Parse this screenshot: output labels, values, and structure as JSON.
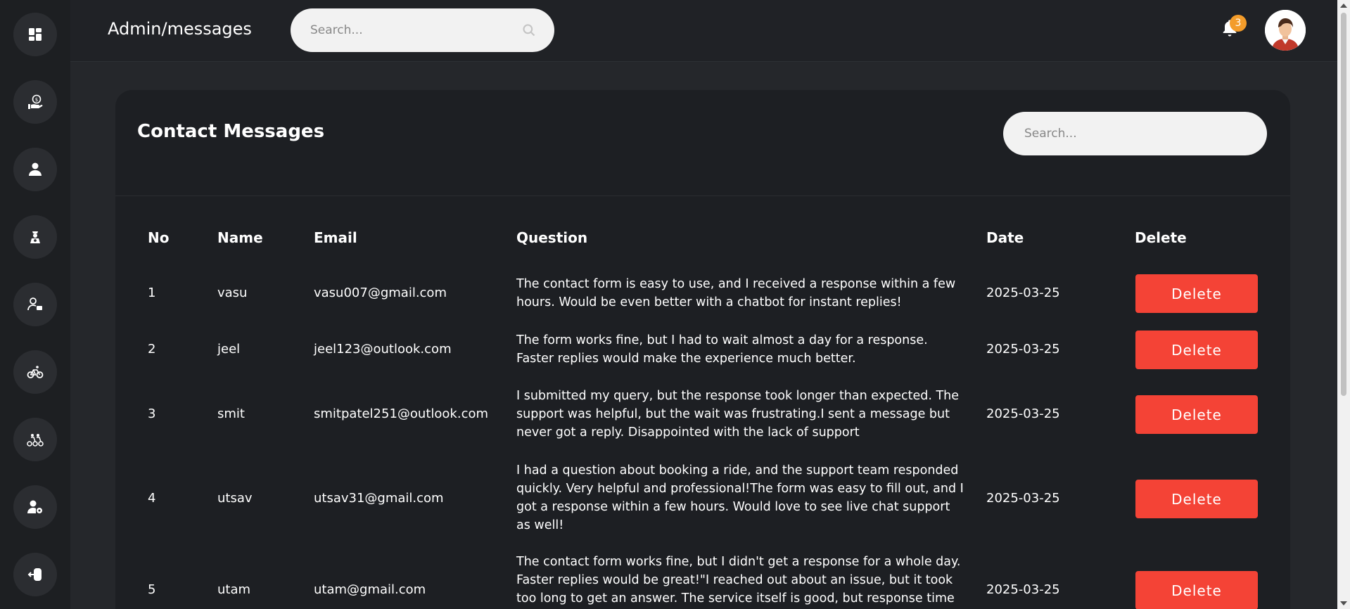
{
  "header": {
    "title": "Admin/messages",
    "search_placeholder": "Search...",
    "notification_count": "3"
  },
  "sidebar": {
    "items": [
      {
        "icon": "dashboard-icon"
      },
      {
        "icon": "payment-hand-icon"
      },
      {
        "icon": "user-icon"
      },
      {
        "icon": "driver-icon"
      },
      {
        "icon": "user-card-icon"
      },
      {
        "icon": "bike-icon"
      },
      {
        "icon": "bikes-icon"
      },
      {
        "icon": "user-settings-icon"
      },
      {
        "icon": "logout-icon"
      }
    ]
  },
  "main": {
    "title": "Contact Messages",
    "search_placeholder": "Search...",
    "columns": [
      "No",
      "Name",
      "Email",
      "Question",
      "Date",
      "Delete"
    ],
    "delete_label": "Delete",
    "rows": [
      {
        "no": "1",
        "name": "vasu",
        "email": "vasu007@gmail.com",
        "question": "The contact form is easy to use, and I received a response within a few hours. Would be even better with a chatbot for instant replies!",
        "date": "2025-03-25"
      },
      {
        "no": "2",
        "name": "jeel",
        "email": "jeel123@outlook.com",
        "question": "The form works fine, but I had to wait almost a day for a response. Faster replies would make the experience much better.",
        "date": "2025-03-25"
      },
      {
        "no": "3",
        "name": "smit",
        "email": "smitpatel251@outlook.com",
        "question": "I submitted my query, but the response took longer than expected. The support was helpful, but the wait was frustrating.I sent a message but never got a reply. Disappointed with the lack of support",
        "date": "2025-03-25"
      },
      {
        "no": "4",
        "name": "utsav",
        "email": "utsav31@gmail.com",
        "question": "I had a question about booking a ride, and the support team responded quickly. Very helpful and professional!The form was easy to fill out, and I got a response within a few hours. Would love to see live chat support as well!",
        "date": "2025-03-25"
      },
      {
        "no": "5",
        "name": "utam",
        "email": "utam@gmail.com",
        "question": "The contact form works fine, but I didn't get a response for a whole day. Faster replies would be great!\"I reached out about an issue, but it took too long to get an answer. The service itself is good, but response time needs improvement.",
        "date": "2025-03-25"
      }
    ]
  },
  "colors": {
    "accent_delete": "#f44336",
    "badge": "#f39c2a",
    "background": "#25272b",
    "card": "#1d1f23"
  }
}
